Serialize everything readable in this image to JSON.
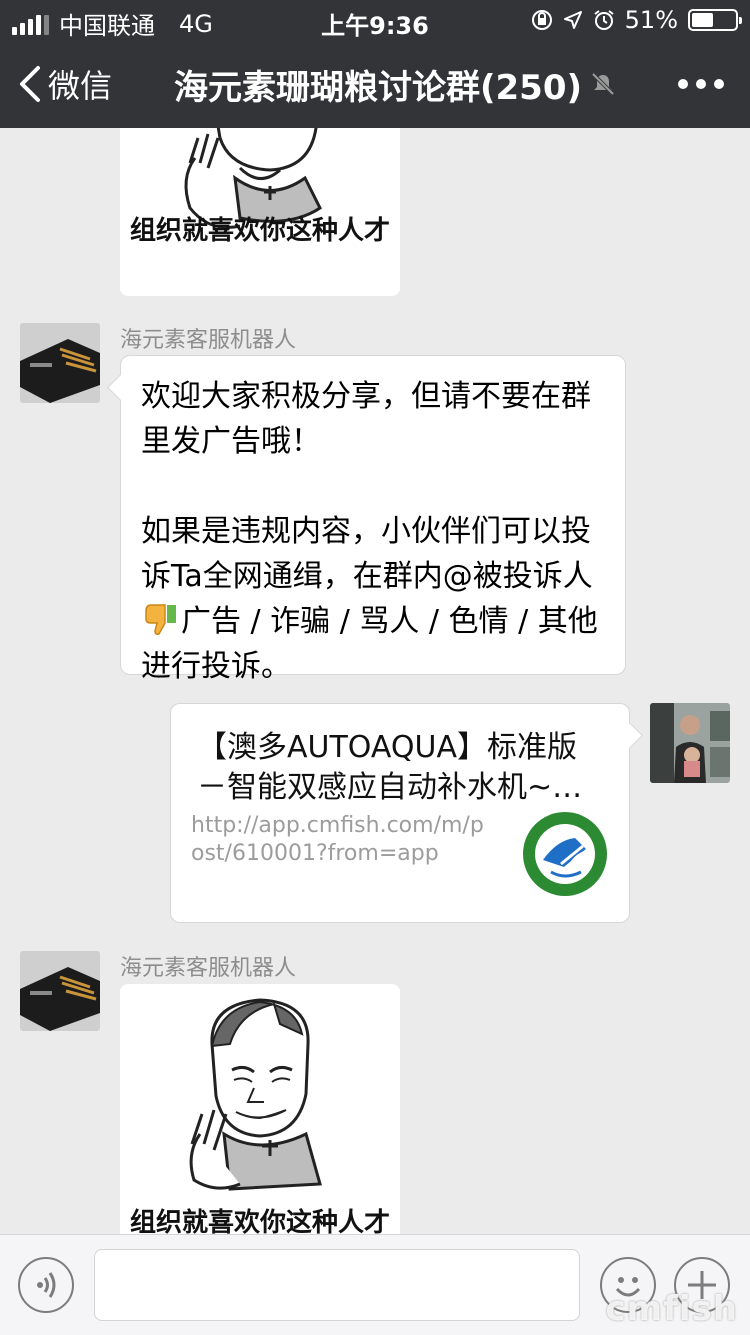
{
  "status_bar": {
    "carrier": "中国联通",
    "network": "4G",
    "time": "上午9:36",
    "battery_text": "51%",
    "battery_level": 0.51
  },
  "nav": {
    "back_label": "微信",
    "title": "海元素珊瑚粮讨论群(250)"
  },
  "messages": [
    {
      "kind": "sticker",
      "caption": "组织就喜欢你这种人才"
    },
    {
      "kind": "text",
      "sender": "海元素客服机器人",
      "paragraph1": "欢迎大家积极分享，但请不要在群里发广告哦！",
      "paragraph2_a": "如果是违规内容，小伙伴们可以投诉Ta全网通缉，在群内@被投诉人",
      "paragraph2_b": "广告 / 诈骗 / 骂人 / 色情 / 其他 进行投诉。"
    },
    {
      "kind": "link",
      "title": "【澳多AUTOAQUA】标准版－智能双感应自动补水机~…",
      "url": "http://app.cmfish.com/m/post/610001?from=app"
    },
    {
      "kind": "sticker",
      "sender": "海元素客服机器人",
      "caption": "组织就喜欢你这种人才"
    }
  ],
  "input_bar": {
    "value": ""
  },
  "watermark": "cmfish"
}
